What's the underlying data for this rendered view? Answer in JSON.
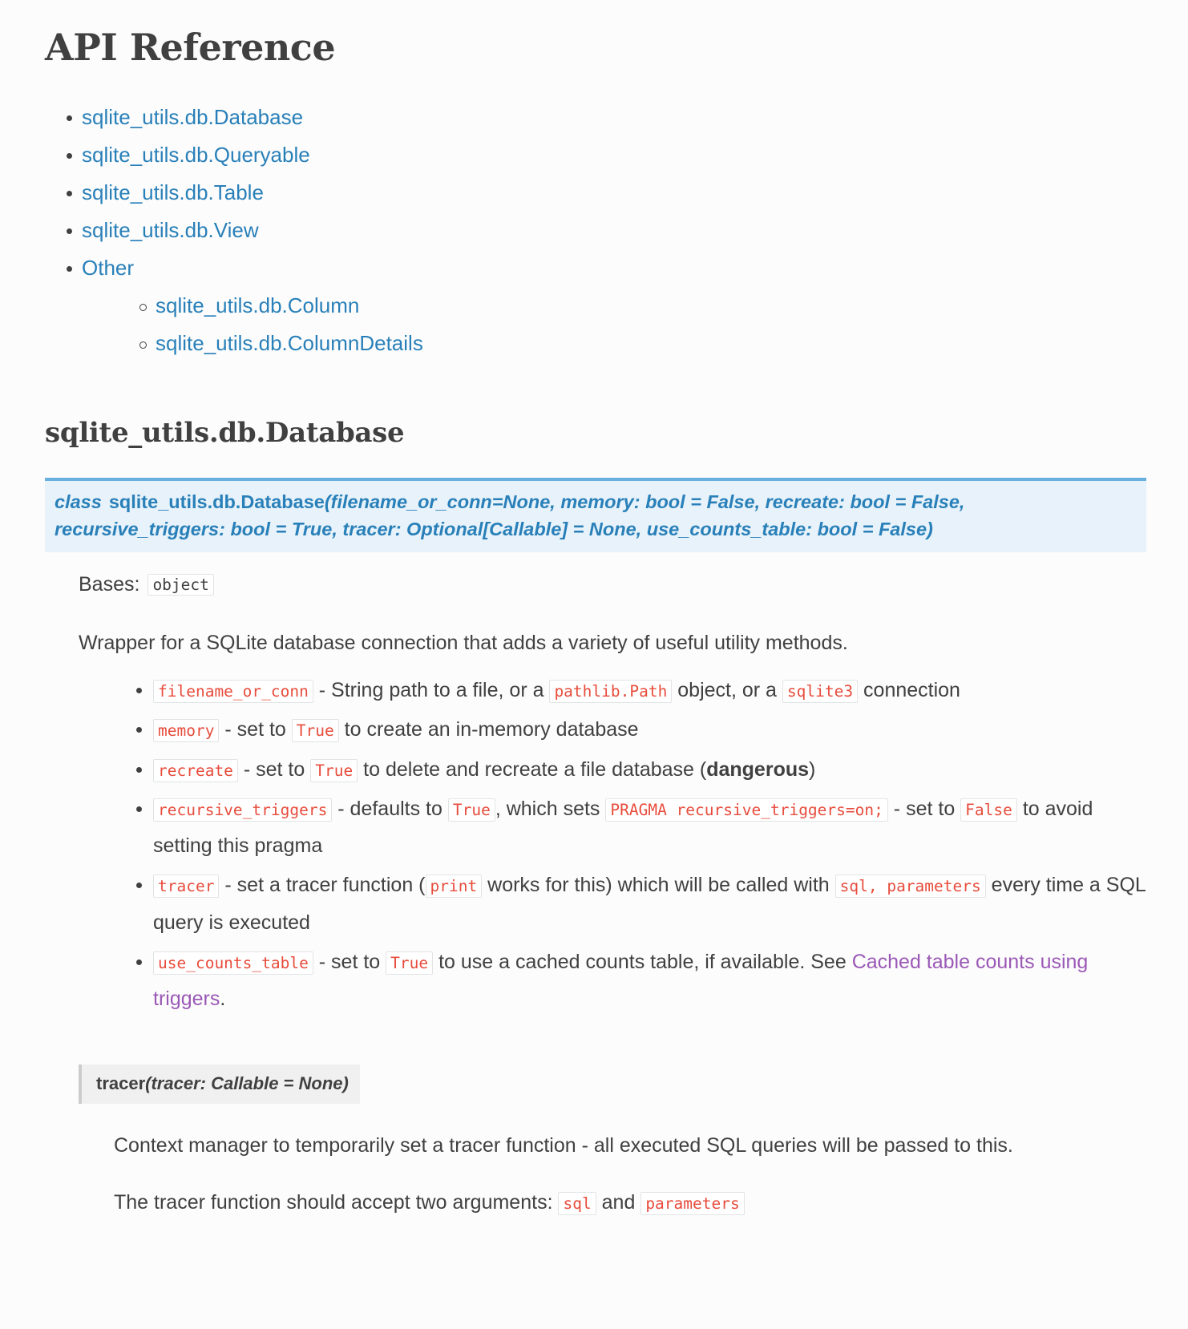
{
  "page": {
    "title": "API Reference"
  },
  "toc": {
    "items": [
      {
        "label": "sqlite_utils.db.Database",
        "children": []
      },
      {
        "label": "sqlite_utils.db.Queryable",
        "children": []
      },
      {
        "label": "sqlite_utils.db.Table",
        "children": []
      },
      {
        "label": "sqlite_utils.db.View",
        "children": []
      },
      {
        "label": "Other",
        "children": [
          {
            "label": "sqlite_utils.db.Column"
          },
          {
            "label": "sqlite_utils.db.ColumnDetails"
          }
        ]
      }
    ]
  },
  "section": {
    "heading": "sqlite_utils.db.Database",
    "signature": {
      "keyword": "class",
      "name": "sqlite_utils.db.Database",
      "params": "(filename_or_conn=None, memory: bool = False, recreate: bool = False, recursive_triggers: bool = True, tracer: Optional[Callable] = None, use_counts_table: bool = False)"
    },
    "bases": {
      "label": "Bases:",
      "value": "object"
    },
    "description": "Wrapper for a SQLite database connection that adds a variety of useful utility methods.",
    "params": [
      {
        "parts": [
          {
            "t": "code",
            "v": "filename_or_conn"
          },
          {
            "t": "text",
            "v": " - String path to a file, or a "
          },
          {
            "t": "code",
            "v": "pathlib.Path"
          },
          {
            "t": "text",
            "v": " object, or a "
          },
          {
            "t": "code",
            "v": "sqlite3"
          },
          {
            "t": "text",
            "v": " connection"
          }
        ]
      },
      {
        "parts": [
          {
            "t": "code",
            "v": "memory"
          },
          {
            "t": "text",
            "v": " - set to "
          },
          {
            "t": "code",
            "v": "True"
          },
          {
            "t": "text",
            "v": " to create an in-memory database"
          }
        ]
      },
      {
        "parts": [
          {
            "t": "code",
            "v": "recreate"
          },
          {
            "t": "text",
            "v": " - set to "
          },
          {
            "t": "code",
            "v": "True"
          },
          {
            "t": "text",
            "v": " to delete and recreate a file database ("
          },
          {
            "t": "bold",
            "v": "dangerous"
          },
          {
            "t": "text",
            "v": ")"
          }
        ]
      },
      {
        "parts": [
          {
            "t": "code",
            "v": "recursive_triggers"
          },
          {
            "t": "text",
            "v": " - defaults to "
          },
          {
            "t": "code",
            "v": "True"
          },
          {
            "t": "text",
            "v": ", which sets "
          },
          {
            "t": "code",
            "v": "PRAGMA recursive_triggers=on;"
          },
          {
            "t": "text",
            "v": " - set to "
          },
          {
            "t": "code",
            "v": "False"
          },
          {
            "t": "text",
            "v": " to avoid setting this pragma"
          }
        ]
      },
      {
        "parts": [
          {
            "t": "code",
            "v": "tracer"
          },
          {
            "t": "text",
            "v": " - set a tracer function ("
          },
          {
            "t": "code",
            "v": "print"
          },
          {
            "t": "text",
            "v": " works for this) which will be called with "
          },
          {
            "t": "code",
            "v": "sql, parameters"
          },
          {
            "t": "text",
            "v": " every time a SQL query is executed"
          }
        ]
      },
      {
        "parts": [
          {
            "t": "code",
            "v": "use_counts_table"
          },
          {
            "t": "text",
            "v": " - set to "
          },
          {
            "t": "code",
            "v": "True"
          },
          {
            "t": "text",
            "v": " to use a cached counts table, if available. See "
          },
          {
            "t": "link",
            "v": "Cached table counts using triggers"
          },
          {
            "t": "text",
            "v": "."
          }
        ]
      }
    ],
    "method": {
      "name": "tracer",
      "params": "(tracer: Callable = None)",
      "paragraphs": [
        {
          "parts": [
            {
              "t": "text",
              "v": "Context manager to temporarily set a tracer function - all executed SQL queries will be passed to this."
            }
          ]
        },
        {
          "parts": [
            {
              "t": "text",
              "v": "The tracer function should accept two arguments: "
            },
            {
              "t": "code",
              "v": "sql"
            },
            {
              "t": "text",
              "v": " and "
            },
            {
              "t": "code",
              "v": "parameters"
            }
          ]
        }
      ]
    }
  },
  "colors": {
    "link": "#2980b9",
    "visited_link": "#9b59b6",
    "code_literal": "#e74c3c",
    "signature_bg": "#e7f2fa",
    "signature_border": "#6ab0de",
    "method_bg": "#f0f0f0",
    "text": "#404040"
  }
}
